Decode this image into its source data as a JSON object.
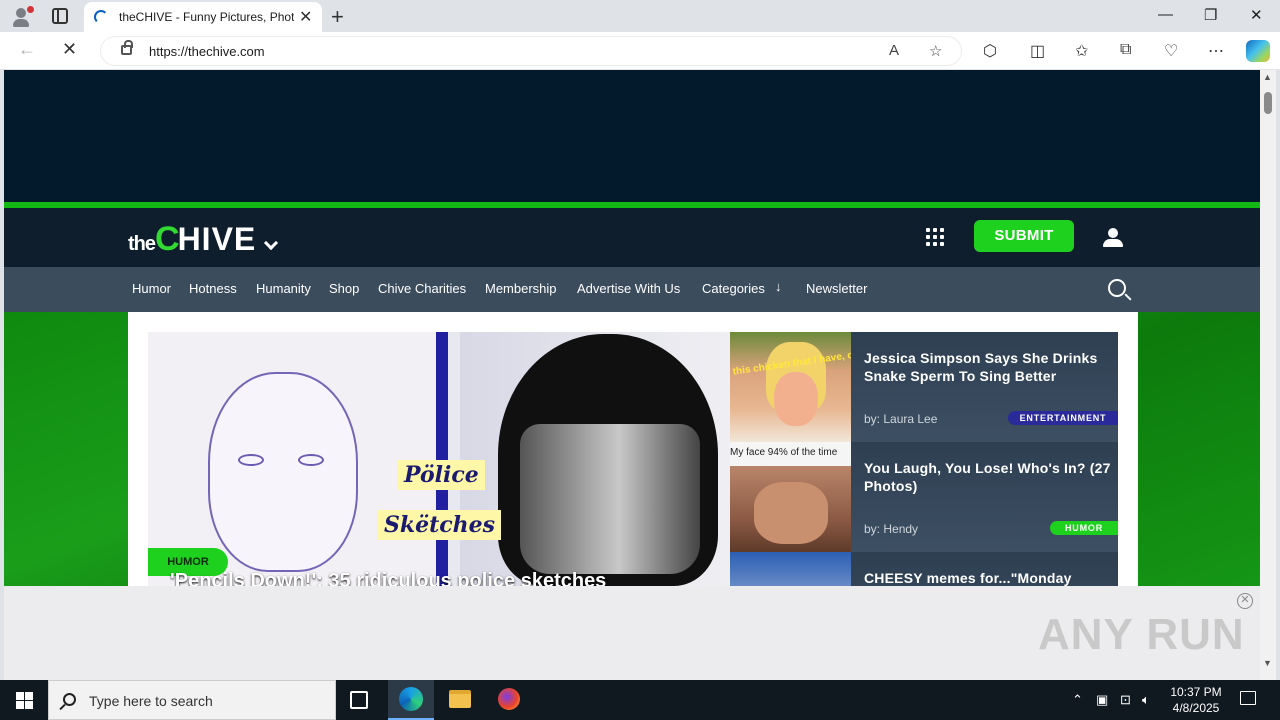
{
  "browser": {
    "tab_title": "theCHIVE - Funny Pictures, Photos, Memes & Videos",
    "new_tab_icon": "plus-icon",
    "url": "https://thechive.com"
  },
  "site": {
    "logo_the": "the",
    "logo_c": "C",
    "logo_hive": "HIVE",
    "submit_label": "SUBMIT",
    "nav_items": [
      "Humor",
      "Hotness",
      "Humanity",
      "Shop",
      "Chive Charities",
      "Membership",
      "Advertise With Us",
      "Categories",
      "Newsletter"
    ],
    "brand_green": "#1fd11f",
    "header_bg": "#0f1e2d",
    "nav_bg": "#3b4c5c"
  },
  "hero": {
    "category": "HUMOR",
    "title": "'Pencils Down!': 35 ridiculous police sketches",
    "image_text_1": "Pölice",
    "image_text_2": "Skëtches"
  },
  "side_articles": [
    {
      "title": "Jessica Simpson Says She Drinks Snake Sperm To Sing Better",
      "by_label": "by:",
      "author": "Laura Lee",
      "tag": "ENTERTAINMENT",
      "tag_color": "#2a2a9a",
      "thumb_text": "this chicken that I have, or is it snake?"
    },
    {
      "title": "You Laugh, You Lose! Who's In? (27 Photos)",
      "by_label": "by:",
      "author": "Hendy",
      "tag": "HUMOR",
      "tag_color": "#1fd11f",
      "thumb_text": "My face 94% of the time"
    },
    {
      "title": "CHEESY memes for...\"Monday",
      "by_label": "",
      "author": "",
      "tag": "",
      "tag_color": "",
      "thumb_text": ""
    }
  ],
  "watermark": "ANY RUN",
  "taskbar": {
    "search_placeholder": "Type here to search",
    "time": "10:37 PM",
    "date": "4/8/2025"
  }
}
